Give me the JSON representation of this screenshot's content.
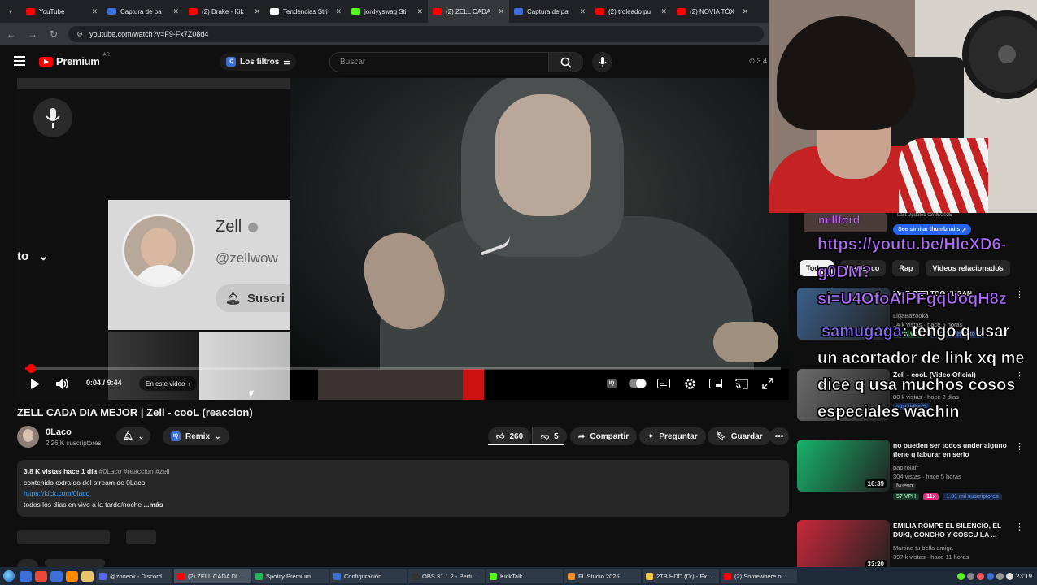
{
  "browser": {
    "tabs": [
      {
        "title": "YouTube",
        "color": "#ff0000"
      },
      {
        "title": "Captura de pa",
        "color": "#3d6fd8"
      },
      {
        "title": "(2) Drake - Kik",
        "color": "#ff0000"
      },
      {
        "title": "Tendencias Stri",
        "color": "#ffffff"
      },
      {
        "title": "jordyyswag Sti",
        "color": "#53fc18"
      },
      {
        "title": "(2) ZELL CADA",
        "color": "#ff0000",
        "active": true
      },
      {
        "title": "Captura de pa",
        "color": "#3d6fd8"
      },
      {
        "title": "(2) troleado pu",
        "color": "#ff0000"
      },
      {
        "title": "(2) NOVIA TÓX",
        "color": "#ff0000"
      }
    ],
    "url": "youtube.com/watch?v=F9-Fx7Z08d4"
  },
  "youtube": {
    "logo_text": "Premium",
    "logo_region": "AR",
    "filters_label": "Los filtros",
    "search_placeholder": "Buscar",
    "topright_text": "3,4"
  },
  "player": {
    "side_text": "to",
    "card_name": "Zell",
    "card_handle": "@zellwow",
    "card_subscribe": "Suscri",
    "current_time": "0:04",
    "time_sep": "/",
    "duration": "9:44",
    "progress_fraction": 0.007,
    "chapter_label": "En este video"
  },
  "video": {
    "title": "ZELL CADA DIA MEJOR | Zell - cooL (reaccion)",
    "channel": "0Laco",
    "subscribers": "2.26 K suscriptores",
    "remix_label": "Remix",
    "likes": "260",
    "dislikes": "5",
    "share_label": "Compartir",
    "ask_label": "Preguntar",
    "save_label": "Guardar",
    "desc_stats": "3.8 K vistas  hace 1 día",
    "desc_tags": "#0Laco #reaccion #zell",
    "desc_line1": "contenido extraído del stream de 0Laco",
    "desc_link": "https://kick.com/0laco",
    "desc_line3": "todos los días en vivo a la tarde/noche",
    "desc_more": "...más"
  },
  "overlay": {
    "top_name": "millford",
    "last_updated": "Last Updated 03/26/2025",
    "similar_btn": "See similar thumbnails",
    "chat_lines": [
      {
        "text": "https://youtu.be/HleXD6-"
      },
      {
        "text": "g0DM?"
      },
      {
        "text": "si=U4OfoAlPFgqUoqH8z"
      },
      {
        "user": "samugaga",
        "text": ": tengo q usar"
      },
      {
        "text": "un acortador de link xq me"
      },
      {
        "text": "dice q usa muchos cosos"
      },
      {
        "text": "especiales wachin"
      }
    ]
  },
  "recommendations": {
    "chips": [
      "Todos",
      "De 0Laco",
      "Rap",
      "Videos relacionados"
    ],
    "items": [
      {
        "title": "[ACE-CEF] TOO YUGAN...",
        "channel": "LigaBazooka",
        "meta": "14 k vistas · hace 5 horas",
        "vph": "2.1K VPH",
        "subs": "323 mil suscriptores",
        "thumb": "#3b5f8a",
        "duration": ""
      },
      {
        "title": "Zell - cooL (Video Oficial)",
        "channel": "",
        "meta": "80 k vistas · hace 2 días",
        "vph": "",
        "subs": "suscriptores",
        "thumb": "#6c6c6c",
        "duration": ""
      },
      {
        "title": "no pueden ser todos under alguno tiene q laburar en serio",
        "channel": "papirolafr",
        "meta": "304 vistas · hace 5 horas",
        "badge_new": "Nuevo",
        "vph": "57 VPH",
        "mult": "11x",
        "subs": "1.31 mil suscriptores",
        "thumb": "#17b36b",
        "duration": "16:39"
      },
      {
        "title": "EMILIA ROMPE EL SILENCIO, EL DUKI, GONCHO Y COSCU LA ...",
        "channel": "Martina tu bella amiga",
        "meta": "397 k vistas · hace 11 horas",
        "thumb": "#c8283a",
        "duration": "33:20"
      }
    ]
  },
  "taskbar": {
    "items": [
      {
        "label": "@zhoeok - Discord",
        "color": "#5865f2"
      },
      {
        "label": "(2) ZELL CADA DI...",
        "color": "#ff0000",
        "active": true
      },
      {
        "label": "Spotify Premium",
        "color": "#1db954"
      },
      {
        "label": "Configuración",
        "color": "#3d6fd8"
      },
      {
        "label": "OBS 31.1.2 - Perfi...",
        "color": "#333333"
      },
      {
        "label": "KickTalk",
        "color": "#53fc18"
      },
      {
        "label": "FL Studio 2025",
        "color": "#f28c28"
      },
      {
        "label": "2TB HDD (D:) - Ex...",
        "color": "#f3c542"
      },
      {
        "label": "(2) Somewhere o...",
        "color": "#ff0000"
      }
    ],
    "clock": "23:19"
  }
}
